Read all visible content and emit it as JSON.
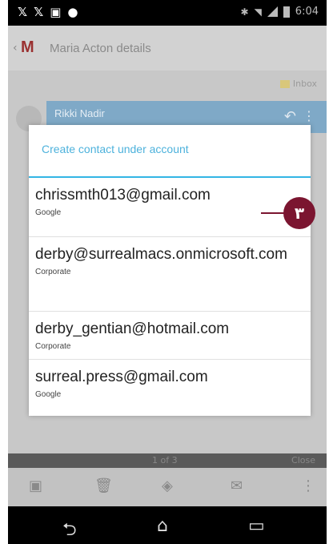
{
  "status_bar": {
    "left_icons": [
      "twitter-icon",
      "twitter-icon",
      "image-icon",
      "message-icon"
    ],
    "time": "6:04"
  },
  "action_bar": {
    "title": "Maria Acton details"
  },
  "label_inbox": "Inbox",
  "sender_name": "Rikki Nadir",
  "dialog": {
    "title": "Create contact under account",
    "accounts": [
      {
        "email": "chrissmth013@gmail.com",
        "type": "Google"
      },
      {
        "email": "derby@surrealmacs.onmicrosoft.com",
        "type": "Corporate"
      },
      {
        "email": "derby_gentian@hotmail.com",
        "type": "Corporate"
      },
      {
        "email": "surreal.press@gmail.com",
        "type": "Google"
      }
    ]
  },
  "callout": {
    "label": "٣",
    "color": "#7b1530"
  },
  "pager": {
    "page": "1 of 3",
    "close": "Close"
  },
  "accent_color": "#33b5e5"
}
